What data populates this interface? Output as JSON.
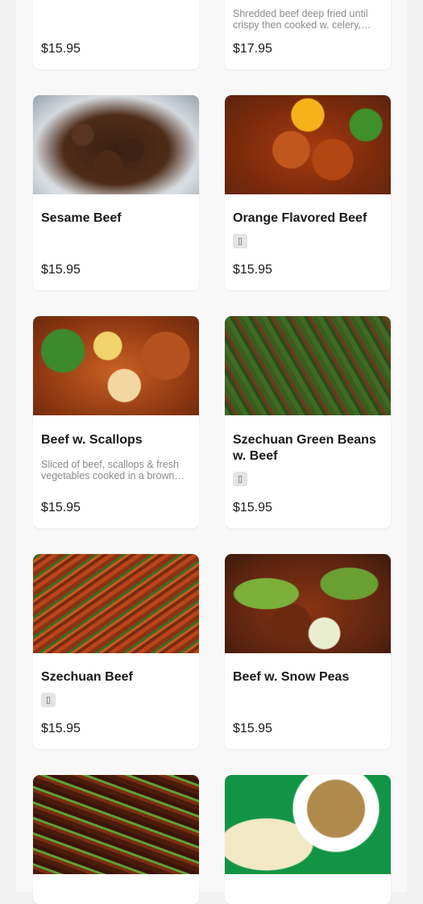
{
  "menu": {
    "items": [
      {
        "name": "",
        "description": "",
        "price": "$15.95",
        "spicy": false,
        "image": "plate"
      },
      {
        "name": "",
        "description": "Shredded beef deep fried until crispy then cooked w. celery, carrots in a spicy sauce",
        "price": "$17.95",
        "spicy": false,
        "image": "plate"
      },
      {
        "name": "Sesame Beef",
        "description": "",
        "price": "$15.95",
        "spicy": false,
        "image": "dark-beef"
      },
      {
        "name": "Orange Flavored Beef",
        "description": "",
        "price": "$15.95",
        "spicy": true,
        "image": "orange-beef"
      },
      {
        "name": "Beef w. Scallops",
        "description": "Sliced of beef, scallops & fresh vegetables cooked in a brown sauce",
        "price": "$15.95",
        "spicy": false,
        "image": "scallop-beef"
      },
      {
        "name": "Szechuan Green Beans w. Beef",
        "description": "",
        "price": "$15.95",
        "spicy": true,
        "image": "green-beans-beef"
      },
      {
        "name": "Szechuan Beef",
        "description": "",
        "price": "$15.95",
        "spicy": true,
        "image": "szechuan-beef"
      },
      {
        "name": "Beef w. Snow Peas",
        "description": "",
        "price": "$15.95",
        "spicy": false,
        "image": "snow-pea-beef"
      },
      {
        "name": "",
        "description": "",
        "price": "",
        "spicy": false,
        "image": "scallion-beef"
      },
      {
        "name": "",
        "description": "",
        "price": "",
        "spicy": false,
        "image": "moo-shu-beef"
      }
    ]
  },
  "icons": {
    "spicy": "pepper-icon",
    "spicy_glyph": "▯"
  },
  "colors": {
    "card_bg": "#ffffff",
    "page_bg": "#f2f2f2",
    "desc_text": "#8a8a8a",
    "price_text": "#1a1a1a"
  }
}
